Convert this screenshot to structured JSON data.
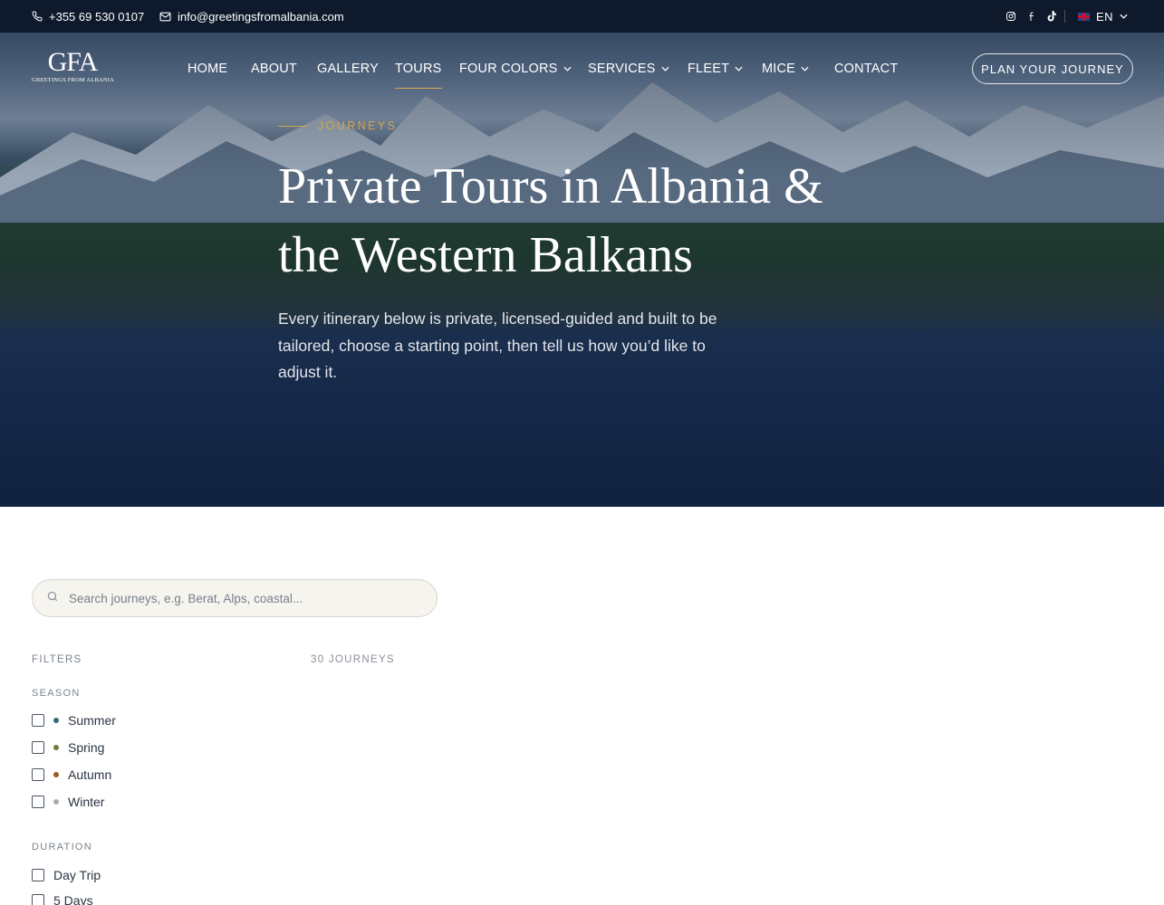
{
  "topbar": {
    "phone": "+355 69 530 0107",
    "email": "info@greetingsfromalbania.com",
    "socials": [
      "instagram-icon",
      "facebook-icon",
      "tiktok-icon"
    ],
    "language": "EN"
  },
  "logo": {
    "mark": "GFA",
    "tagline": "GREETINGS FROM ALBANIA"
  },
  "nav": {
    "items": [
      {
        "label": "HOME",
        "dropdown": false
      },
      {
        "label": "ABOUT",
        "dropdown": false
      },
      {
        "label": "GALLERY",
        "dropdown": false
      },
      {
        "label": "TOURS",
        "dropdown": false,
        "active": true
      },
      {
        "label": "FOUR COLORS",
        "dropdown": true
      },
      {
        "label": "SERVICES",
        "dropdown": true
      },
      {
        "label": "FLEET",
        "dropdown": true
      },
      {
        "label": "MICE",
        "dropdown": true
      },
      {
        "label": "CONTACT",
        "dropdown": false
      }
    ],
    "cta": "PLAN YOUR JOURNEY"
  },
  "hero": {
    "eyebrow": "JOURNEYS",
    "title_line1": "Private Tours in Albania &",
    "title_line2": "the Western Balkans",
    "lead": "Every itinerary below is private, licensed-guided and built to be tailored, choose a starting point, then tell us how you’d like to adjust it."
  },
  "search": {
    "placeholder": "Search journeys, e.g. Berat, Alps, coastal...",
    "value": ""
  },
  "filters": {
    "heading": "FILTERS",
    "season": {
      "heading": "SEASON",
      "options": [
        {
          "label": "Summer",
          "color": "#2f6f74",
          "checked": false
        },
        {
          "label": "Spring",
          "color": "#6a7a3c",
          "checked": false
        },
        {
          "label": "Autumn",
          "color": "#9a5a22",
          "checked": false
        },
        {
          "label": "Winter",
          "color": "#a9adb3",
          "checked": false
        }
      ]
    },
    "duration": {
      "heading": "DURATION",
      "options": [
        {
          "label": "Day Trip",
          "checked": false
        },
        {
          "label": "5 Days",
          "checked": false
        }
      ]
    }
  },
  "results": {
    "count_label": "30 JOURNEYS"
  },
  "colors": {
    "accent": "#d4a64a",
    "topbar": "#0e1a2c",
    "hero_overlay": "#14274a"
  }
}
